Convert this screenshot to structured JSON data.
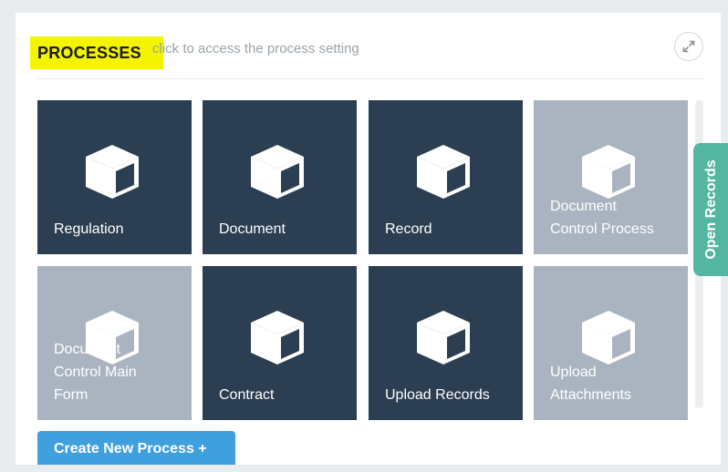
{
  "header": {
    "title": "PROCESSES",
    "subtitle": "click to access the process setting",
    "expand_icon": "expand-arrows-icon"
  },
  "tiles": [
    {
      "label": "Regulation",
      "style": "dark",
      "icon": "cube-icon"
    },
    {
      "label": "Document",
      "style": "dark",
      "icon": "cube-icon"
    },
    {
      "label": "Record",
      "style": "dark",
      "icon": "cube-icon"
    },
    {
      "label": "Document\nControl Process",
      "style": "light",
      "icon": "cube-icon"
    },
    {
      "label": "Document\nControl Main\nForm",
      "style": "light",
      "icon": "cube-icon"
    },
    {
      "label": "Contract",
      "style": "dark",
      "icon": "cube-icon"
    },
    {
      "label": "Upload Records",
      "style": "dark",
      "icon": "cube-icon"
    },
    {
      "label": "Upload\nAttachments",
      "style": "light",
      "icon": "cube-icon"
    }
  ],
  "footer": {
    "create_button_label": "Create New Process +"
  },
  "side_tab": {
    "label": "Open Records"
  },
  "colors": {
    "tile_dark": "#2c3e51",
    "tile_light": "#aab4c1",
    "accent_teal": "#52b6a1",
    "button_blue": "#3f9fdf",
    "highlight_yellow": "#f4f400"
  }
}
